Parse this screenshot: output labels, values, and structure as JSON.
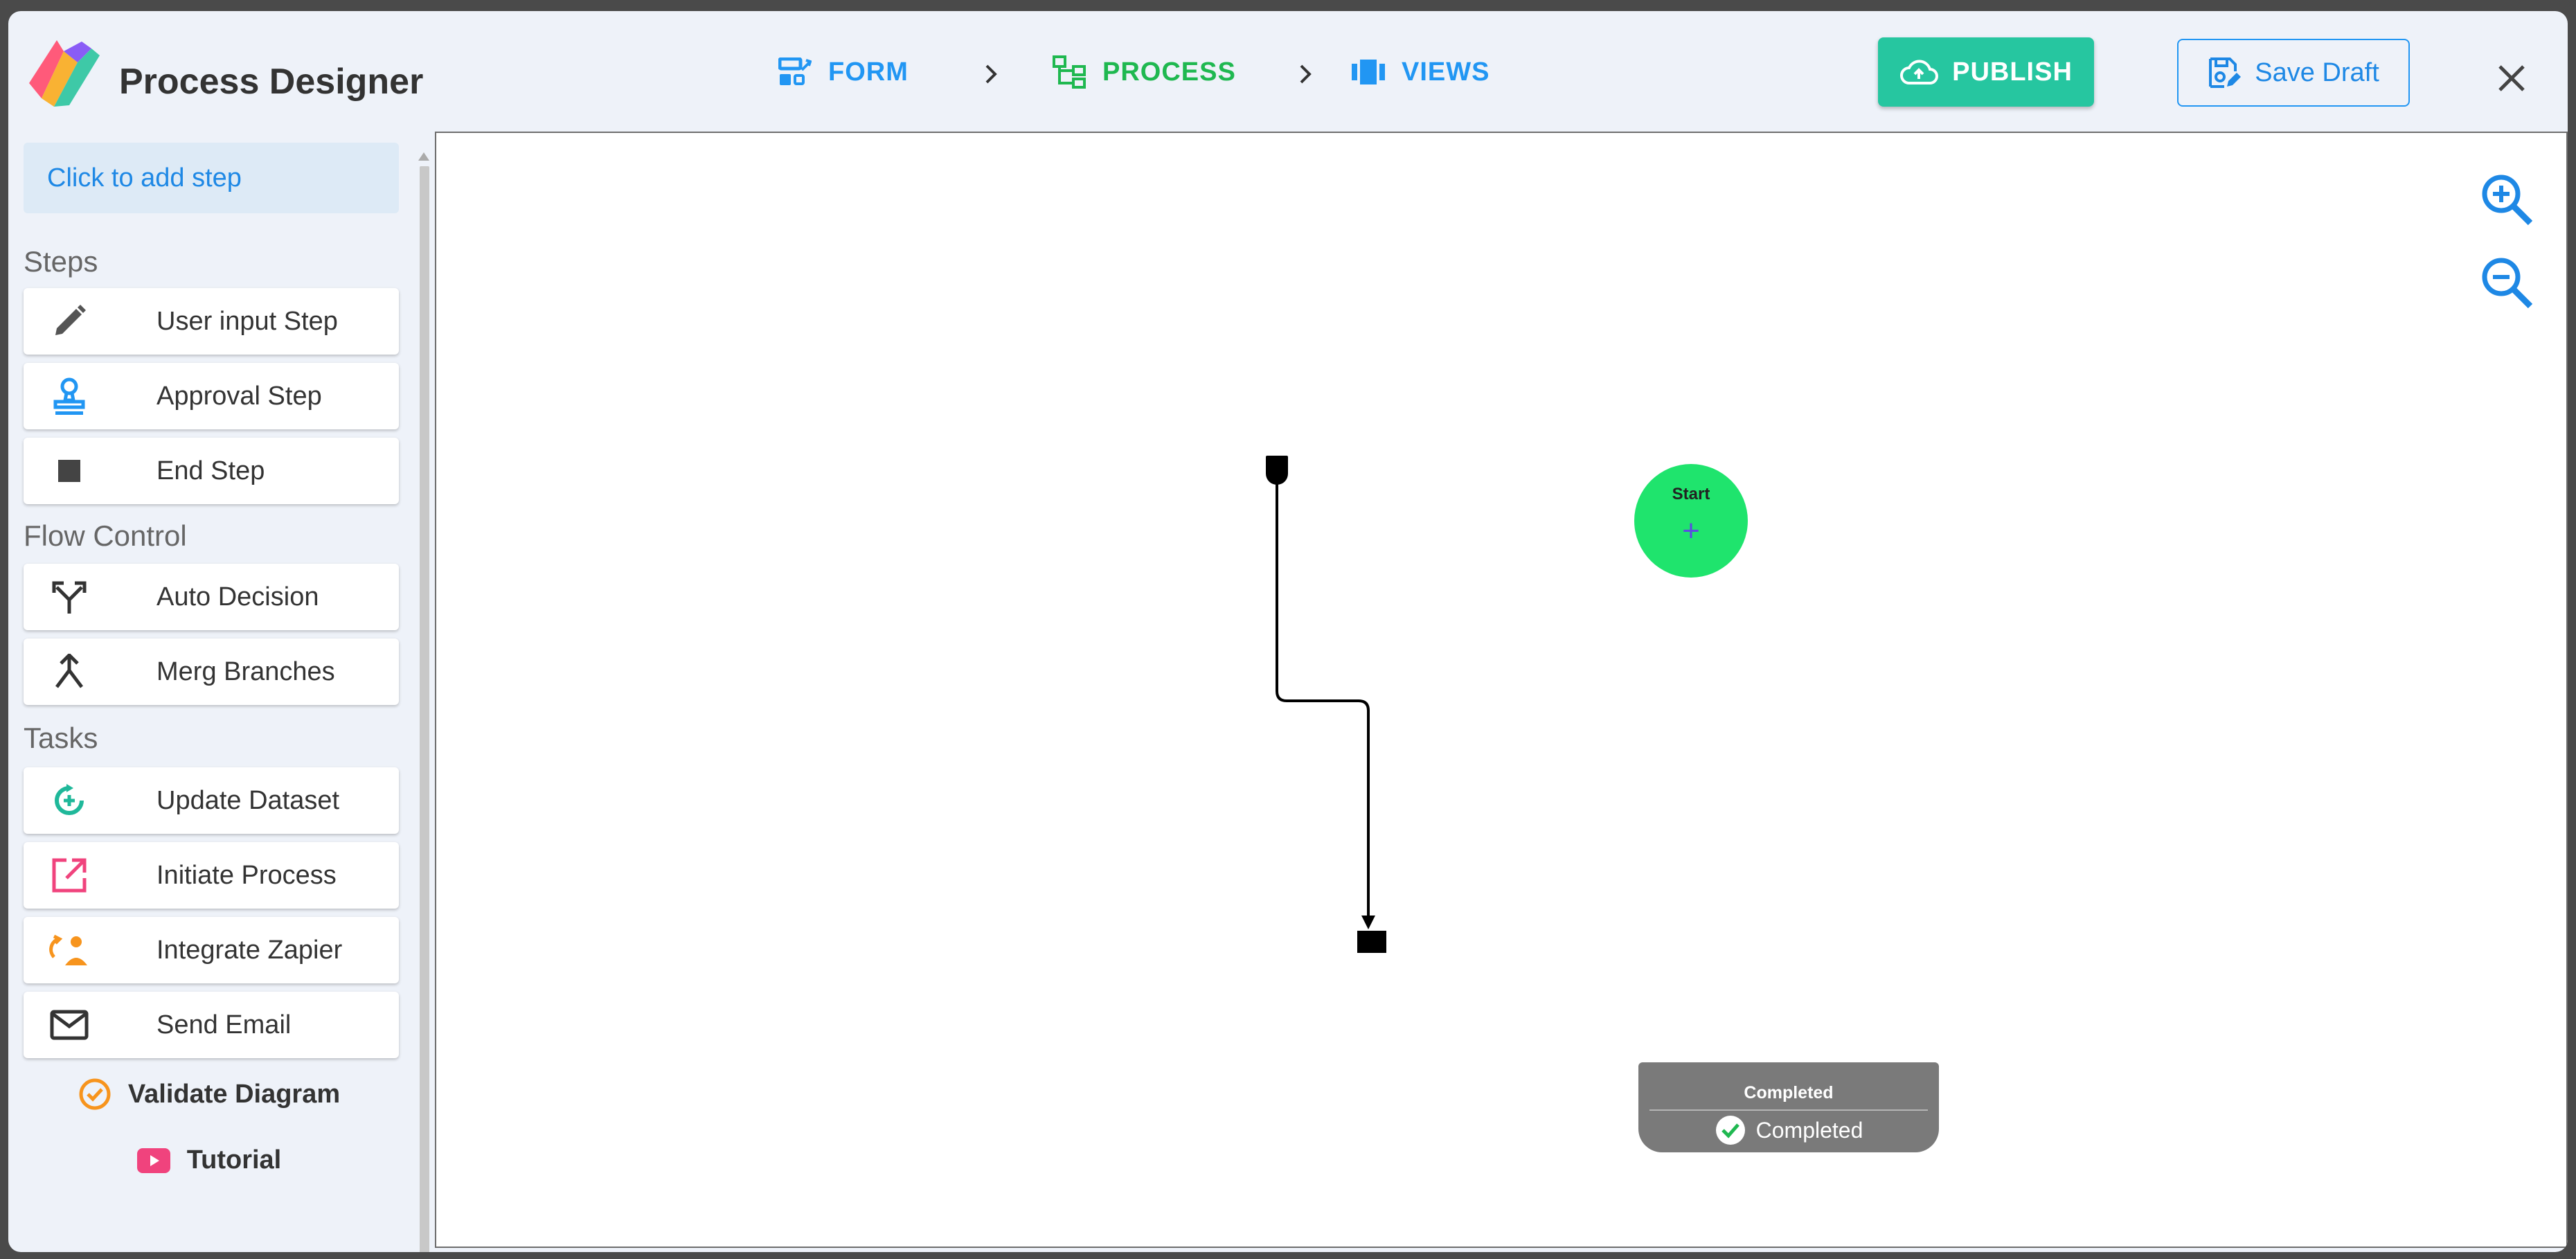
{
  "app": {
    "title": "Process Designer"
  },
  "nav": {
    "form": "FORM",
    "process": "PROCESS",
    "views": "VIEWS",
    "active": "PROCESS"
  },
  "actions": {
    "publish": "PUBLISH",
    "save_draft": "Save Draft"
  },
  "sidebar": {
    "add_step": "Click to add step",
    "sections": [
      {
        "label": "Steps",
        "items": [
          {
            "label": "User input Step",
            "icon": "pencil-icon"
          },
          {
            "label": "Approval Step",
            "icon": "stamp-icon"
          },
          {
            "label": "End Step",
            "icon": "stop-square-icon"
          }
        ]
      },
      {
        "label": "Flow Control",
        "items": [
          {
            "label": "Auto Decision",
            "icon": "split-arrows-icon"
          },
          {
            "label": "Merg Branches",
            "icon": "merge-icon"
          }
        ]
      },
      {
        "label": "Tasks",
        "items": [
          {
            "label": "Update Dataset",
            "icon": "dataset-refresh-icon"
          },
          {
            "label": "Initiate Process",
            "icon": "open-in-new-icon"
          },
          {
            "label": "Integrate Zapier",
            "icon": "zapier-icon"
          },
          {
            "label": "Send Email",
            "icon": "mail-icon"
          }
        ]
      }
    ],
    "validate": "Validate Diagram",
    "tutorial": "Tutorial"
  },
  "diagram": {
    "start": {
      "title": "Start",
      "add_symbol": "+"
    },
    "end": {
      "title": "Completed",
      "status": "Completed"
    }
  },
  "colors": {
    "accent_blue": "#2196f3",
    "process_green": "#1fb850",
    "publish_teal": "#26c6a0",
    "start_node": "#1fe46d",
    "end_node": "#7a7a7a"
  }
}
